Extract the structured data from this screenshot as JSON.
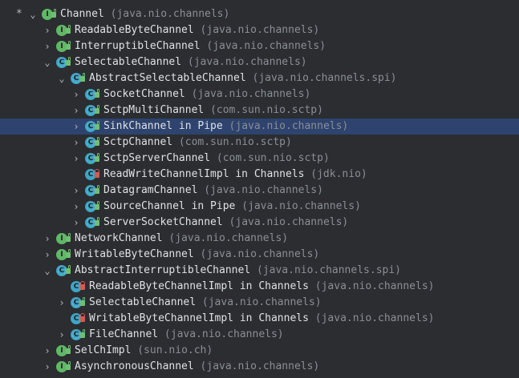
{
  "rows": [
    {
      "name": "Channel",
      "pkg": "(java.nio.channels)",
      "arrow": "⌄",
      "star": "*",
      "icon": "I",
      "kind": "iface",
      "access": "public",
      "selected": false
    },
    {
      "name": "ReadableByteChannel",
      "pkg": "(java.nio.channels)",
      "arrow": "›",
      "star": "",
      "icon": "I",
      "kind": "iface",
      "access": "public",
      "selected": false
    },
    {
      "name": "InterruptibleChannel",
      "pkg": "(java.nio.channels)",
      "arrow": "›",
      "star": "",
      "icon": "I",
      "kind": "iface",
      "access": "public",
      "selected": false
    },
    {
      "name": "SelectableChannel",
      "pkg": "(java.nio.channels)",
      "arrow": "⌄",
      "star": "",
      "icon": "C",
      "kind": "abstract",
      "access": "public",
      "selected": false
    },
    {
      "name": "AbstractSelectableChannel",
      "pkg": "(java.nio.channels.spi)",
      "arrow": "⌄",
      "star": "",
      "icon": "C",
      "kind": "abstract",
      "access": "public",
      "selected": false
    },
    {
      "name": "SocketChannel",
      "pkg": "(java.nio.channels)",
      "arrow": "›",
      "star": "",
      "icon": "C",
      "kind": "abstract",
      "access": "public",
      "selected": false
    },
    {
      "name": "SctpMultiChannel",
      "pkg": "(com.sun.nio.sctp)",
      "arrow": "›",
      "star": "",
      "icon": "C",
      "kind": "abstract",
      "access": "public",
      "selected": false
    },
    {
      "name": "SinkChannel in Pipe",
      "pkg": "(java.nio.channels)",
      "arrow": "›",
      "star": "",
      "icon": "C",
      "kind": "abstract",
      "access": "public",
      "selected": true
    },
    {
      "name": "SctpChannel",
      "pkg": "(com.sun.nio.sctp)",
      "arrow": "›",
      "star": "",
      "icon": "C",
      "kind": "abstract",
      "access": "public",
      "selected": false
    },
    {
      "name": "SctpServerChannel",
      "pkg": "(com.sun.nio.sctp)",
      "arrow": "›",
      "star": "",
      "icon": "C",
      "kind": "abstract",
      "access": "public",
      "selected": false
    },
    {
      "name": "ReadWriteChannelImpl in Channels",
      "pkg": "(jdk.nio)",
      "arrow": "",
      "star": "",
      "icon": "C",
      "kind": "cls",
      "access": "private",
      "selected": false
    },
    {
      "name": "DatagramChannel",
      "pkg": "(java.nio.channels)",
      "arrow": "›",
      "star": "",
      "icon": "C",
      "kind": "abstract",
      "access": "public",
      "selected": false
    },
    {
      "name": "SourceChannel in Pipe",
      "pkg": "(java.nio.channels)",
      "arrow": "›",
      "star": "",
      "icon": "C",
      "kind": "abstract",
      "access": "public",
      "selected": false
    },
    {
      "name": "ServerSocketChannel",
      "pkg": "(java.nio.channels)",
      "arrow": "›",
      "star": "",
      "icon": "C",
      "kind": "abstract",
      "access": "public",
      "selected": false
    },
    {
      "name": "NetworkChannel",
      "pkg": "(java.nio.channels)",
      "arrow": "›",
      "star": "",
      "icon": "I",
      "kind": "iface",
      "access": "public",
      "selected": false
    },
    {
      "name": "WritableByteChannel",
      "pkg": "(java.nio.channels)",
      "arrow": "›",
      "star": "",
      "icon": "I",
      "kind": "iface",
      "access": "public",
      "selected": false
    },
    {
      "name": "AbstractInterruptibleChannel",
      "pkg": "(java.nio.channels.spi)",
      "arrow": "⌄",
      "star": "",
      "icon": "C",
      "kind": "abstract",
      "access": "public",
      "selected": false
    },
    {
      "name": "ReadableByteChannelImpl in Channels",
      "pkg": "(java.nio.channels)",
      "arrow": "",
      "star": "",
      "icon": "C",
      "kind": "cls",
      "access": "private",
      "selected": false
    },
    {
      "name": "SelectableChannel",
      "pkg": "(java.nio.channels)",
      "arrow": "›",
      "star": "",
      "icon": "C",
      "kind": "abstract",
      "access": "public",
      "selected": false
    },
    {
      "name": "WritableByteChannelImpl in Channels",
      "pkg": "(java.nio.channels)",
      "arrow": "",
      "star": "",
      "icon": "C",
      "kind": "cls",
      "access": "private",
      "selected": false
    },
    {
      "name": "FileChannel",
      "pkg": "(java.nio.channels)",
      "arrow": "›",
      "star": "",
      "icon": "C",
      "kind": "abstract",
      "access": "public",
      "selected": false
    },
    {
      "name": "SelChImpl",
      "pkg": "(sun.nio.ch)",
      "arrow": "›",
      "star": "",
      "icon": "I",
      "kind": "iface",
      "access": "public",
      "selected": false
    },
    {
      "name": "AsynchronousChannel",
      "pkg": "(java.nio.channels)",
      "arrow": "›",
      "star": "",
      "icon": "I",
      "kind": "iface",
      "access": "public",
      "selected": false
    }
  ],
  "colors": {
    "background": "#2b2d30",
    "selection": "#2e436e",
    "interface_icon": "#5fb865",
    "class_icon": "#3fa5c6",
    "public_access": "#6fbf73",
    "private_access": "#d25c4e",
    "name_text": "#dfe1e5",
    "package_text": "#8a8e96"
  }
}
